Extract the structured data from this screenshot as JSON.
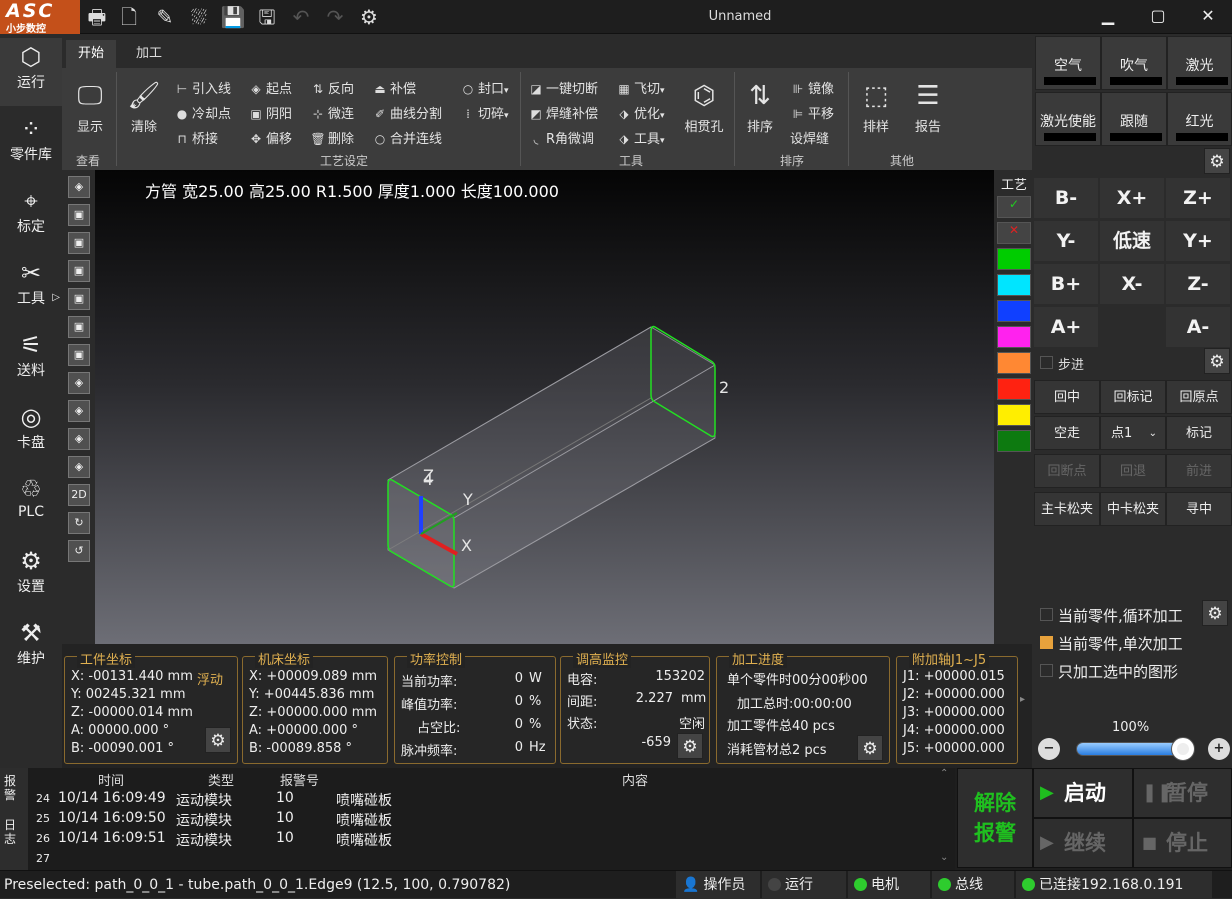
{
  "app": {
    "logo_text": "ASC",
    "logo_sub": "小步数控",
    "title": "Unnamed"
  },
  "nav": [
    {
      "label": "运行",
      "icon": "cube-icon"
    },
    {
      "label": "零件库",
      "icon": "parts-grid-icon"
    },
    {
      "label": "标定",
      "icon": "crosshair-icon"
    },
    {
      "label": "工具",
      "icon": "wrench-icon"
    },
    {
      "label": "送料",
      "icon": "feeder-icon"
    },
    {
      "label": "卡盘",
      "icon": "chuck-icon"
    },
    {
      "label": "PLC",
      "icon": "plc-icon"
    },
    {
      "label": "设置",
      "icon": "gear-icon"
    },
    {
      "label": "维护",
      "icon": "maintenance-icon"
    }
  ],
  "ribbon_tabs": [
    "开始",
    "加工"
  ],
  "ribbon": {
    "view": {
      "show": "显示",
      "group": "查看"
    },
    "process": {
      "clear": "清除",
      "lead_in": "引入线",
      "cool_point": "冷却点",
      "bridge": "桥接",
      "start": "起点",
      "yin_yang": "阴阳",
      "offset": "偏移",
      "reverse": "反向",
      "micro_joint": "微连",
      "delete": "删除",
      "compensate": "补偿",
      "curve_split": "曲线分割",
      "merge_lines": "合并连线",
      "seal": "封口",
      "cut_broken": "切碎",
      "group": "工艺设定"
    },
    "tools": {
      "one_key_cut": "一键切断",
      "weld_comp": "焊缝补偿",
      "r_adjust": "R角微调",
      "fly_cut": "飞切",
      "optimize": "优化",
      "tool": "工具",
      "through_hole": "相贯孔",
      "group": "工具"
    },
    "sort": {
      "sort": "排序",
      "mirror": "镜像",
      "translate": "平移",
      "set_weld": "设焊缝",
      "group": "排序"
    },
    "other": {
      "nesting": "排样",
      "report": "报告",
      "group": "其他"
    }
  },
  "view_tools": [
    "cube-iso-icon",
    "view-front-icon",
    "view-back-icon",
    "view-left-icon",
    "view-right-icon",
    "view-top-icon",
    "view-bottom-icon",
    "view-iso1-icon",
    "view-iso2-icon",
    "view-iso3-icon",
    "view-iso4-icon",
    "2D",
    "rotate-cw-icon",
    "rotate-ccw-icon"
  ],
  "viewport": {
    "info": "方管 宽25.00 高25.00 R1.500 厚度1.000 长度100.000",
    "label_2": "2",
    "label_4": "4",
    "axis_x": "X",
    "axis_y": "Y",
    "axis_z": "Z"
  },
  "right_strip": {
    "label": "工艺",
    "colors": [
      "#00cc00",
      "#00e5ff",
      "#1040ff",
      "#ff22ee",
      "#ff8833",
      "#ff2211",
      "#ffee00",
      "#0d7a10"
    ]
  },
  "laser_panel": {
    "air": "空气",
    "blow": "吹气",
    "laser": "激光",
    "laser_enable": "激光使能",
    "follow": "跟随",
    "red_light": "红光"
  },
  "jog": {
    "b_minus": "B-",
    "x_plus": "X+",
    "z_plus": "Z+",
    "y_minus": "Y-",
    "low_speed": "低速",
    "y_plus": "Y+",
    "b_plus": "B+",
    "x_minus": "X-",
    "z_minus": "Z-",
    "a_plus": "A+",
    "a_minus": "A-",
    "step": "步进"
  },
  "motion": {
    "return_center": "回中",
    "return_mark": "回标记",
    "return_origin": "回原点",
    "dry_run": "空走",
    "point_select": "点1",
    "mark": "标记",
    "return_break": "回断点",
    "back": "回退",
    "forward": "前进",
    "main_chuck": "主卡松夹",
    "mid_chuck": "中卡松夹",
    "seek_edge": "寻中"
  },
  "options": {
    "loop_current": "当前零件,循环加工",
    "single_current": "当前零件,单次加工",
    "only_selected": "只加工选中的图形"
  },
  "speed": {
    "percent": "100%",
    "value": 1.0
  },
  "work_coord": {
    "title": "工件坐标",
    "float_label": "浮动",
    "rows": [
      "X: -00131.440 mm",
      "Y:  00245.321 mm",
      "Z: -00000.014 mm",
      "A:  00000.000 °",
      "B: -00090.001 °"
    ]
  },
  "machine_coord": {
    "title": "机床坐标",
    "rows": [
      "X: +00009.089 mm",
      "Y: +00445.836 mm",
      "Z: +00000.000 mm",
      "A: +00000.000 °",
      "B:  -00089.858 °"
    ]
  },
  "power": {
    "title": "功率控制",
    "rows": [
      {
        "label": "当前功率:",
        "value": "0",
        "unit": "W"
      },
      {
        "label": "峰值功率:",
        "value": "0",
        "unit": "%"
      },
      {
        "label": "占空比:",
        "value": "0",
        "unit": "%"
      },
      {
        "label": "脉冲频率:",
        "value": "0",
        "unit": "Hz"
      }
    ]
  },
  "height_monitor": {
    "title": "调高监控",
    "capacitance_label": "电容:",
    "capacitance": "153202",
    "gap_label": "间距:",
    "gap": "2.227",
    "gap_unit": "mm",
    "state_label": "状态:",
    "state": "空闲",
    "raw": "-659"
  },
  "progress": {
    "title": "加工进度",
    "single_time": "单个零件时00分00秒00",
    "total_time": "加工总时:00:00:00",
    "parts_total": "加工零件总40 pcs",
    "tubes_used": "消耗管材总2 pcs"
  },
  "aux_axes": {
    "title": "附加轴J1~J5",
    "rows": [
      "J1: +00000.015",
      "J2: +00000.000",
      "J3: +00000.000",
      "J4: +00000.000",
      "J5: +00000.000"
    ]
  },
  "log": {
    "side_tabs": [
      "报警",
      "日志"
    ],
    "headers": [
      "时间",
      "类型",
      "报警号",
      "内容"
    ],
    "rows": [
      {
        "n": "24",
        "time": "10/14 16:09:49",
        "type": "运动模块",
        "code": "10",
        "content": "喷嘴碰板"
      },
      {
        "n": "25",
        "time": "10/14 16:09:50",
        "type": "运动模块",
        "code": "10",
        "content": "喷嘴碰板"
      },
      {
        "n": "26",
        "time": "10/14 16:09:51",
        "type": "运动模块",
        "code": "10",
        "content": "喷嘴碰板"
      },
      {
        "n": "27",
        "time": "",
        "type": "",
        "code": "",
        "content": ""
      }
    ]
  },
  "control": {
    "clear_alarm_1": "解除",
    "clear_alarm_2": "报警",
    "start": "启动",
    "pause": "暂停",
    "resume": "继续",
    "stop": "停止"
  },
  "status": {
    "preselect": "Preselected: path_0_0_1 - tube.path_0_0_1.Edge9 (12.5, 100, 0.790782)",
    "operator": "操作员",
    "run": "运行",
    "motor": "电机",
    "bus": "总线",
    "connection": "已连接192.168.0.191"
  }
}
